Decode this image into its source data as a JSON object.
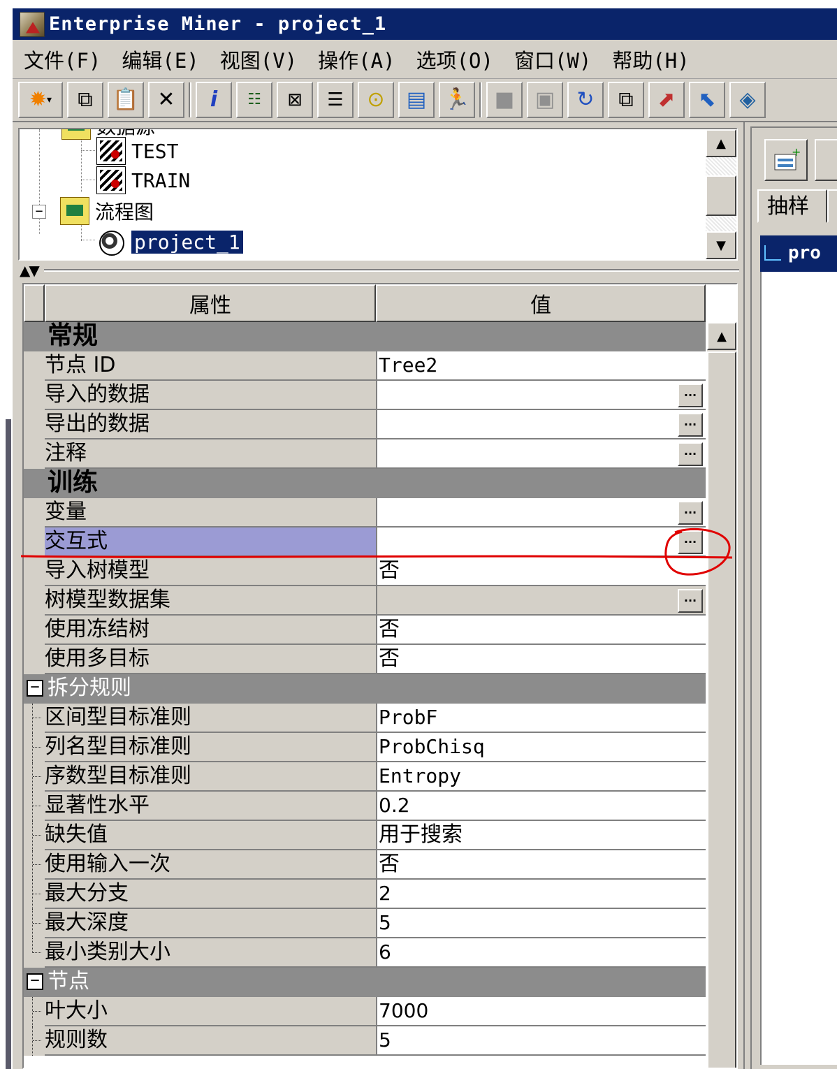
{
  "window": {
    "title": "Enterprise Miner - project_1"
  },
  "menu": [
    "文件(F)",
    "编辑(E)",
    "视图(V)",
    "操作(A)",
    "选项(O)",
    "窗口(W)",
    "帮助(H)"
  ],
  "toolbar": {
    "icons": [
      "new-star-icon",
      "copy-icon",
      "paste-icon",
      "delete-icon",
      "info-icon",
      "tree-view-icon",
      "edit-node-icon",
      "notepad-icon",
      "results-icon",
      "library-icon",
      "run-icon",
      "stop-icon",
      "report-icon",
      "refresh-icon",
      "windows-icon",
      "model-icon",
      "open-icon",
      "book-icon"
    ]
  },
  "tree": {
    "clipped_label": "数据源",
    "items": [
      {
        "label": "TEST",
        "type": "table"
      },
      {
        "label": "TRAIN",
        "type": "table"
      },
      {
        "label": "流程图",
        "type": "folder",
        "expander": "−"
      },
      {
        "label": "project_1",
        "type": "project",
        "selected": true
      }
    ]
  },
  "grid": {
    "header_property": "属性",
    "header_value": "值",
    "rows": [
      {
        "kind": "section",
        "name": "常规"
      },
      {
        "kind": "prop",
        "name": "节点 ID",
        "value": "Tree2",
        "mono": true
      },
      {
        "kind": "prop",
        "name": "导入的数据",
        "value": "",
        "button": "..."
      },
      {
        "kind": "prop",
        "name": "导出的数据",
        "value": "",
        "button": "..."
      },
      {
        "kind": "prop",
        "name": "注释",
        "value": "",
        "button": "..."
      },
      {
        "kind": "section",
        "name": "训练"
      },
      {
        "kind": "prop",
        "name": "变量",
        "value": "",
        "button": "..."
      },
      {
        "kind": "prop",
        "name": "交互式",
        "value": "",
        "button": "...",
        "highlight": true
      },
      {
        "kind": "prop",
        "name": "导入树模型",
        "value": "否"
      },
      {
        "kind": "prop",
        "name": "树模型数据集",
        "value": "",
        "button": "...",
        "gray": true
      },
      {
        "kind": "prop",
        "name": "使用冻结树",
        "value": "否"
      },
      {
        "kind": "prop",
        "name": "使用多目标",
        "value": "否"
      },
      {
        "kind": "group",
        "name": "拆分规则",
        "toggle": "−"
      },
      {
        "kind": "child",
        "name": "区间型目标准则",
        "value": "ProbF",
        "mono": true
      },
      {
        "kind": "child",
        "name": "列名型目标准则",
        "value": "ProbChisq",
        "mono": true
      },
      {
        "kind": "child",
        "name": "序数型目标准则",
        "value": "Entropy",
        "mono": true
      },
      {
        "kind": "child",
        "name": "显著性水平",
        "value": "0.2"
      },
      {
        "kind": "child",
        "name": "缺失值",
        "value": "用于搜索"
      },
      {
        "kind": "child",
        "name": "使用输入一次",
        "value": "否"
      },
      {
        "kind": "child",
        "name": "最大分支",
        "value": "2"
      },
      {
        "kind": "child",
        "name": "最大深度",
        "value": "5"
      },
      {
        "kind": "child",
        "name": "最小类别大小",
        "value": "6",
        "last": true
      },
      {
        "kind": "group",
        "name": "节点",
        "toggle": "−"
      },
      {
        "kind": "child",
        "name": "叶大小",
        "value": "7000"
      },
      {
        "kind": "child",
        "name": "规则数",
        "value": "5"
      }
    ]
  },
  "right": {
    "tab_label": "抽样",
    "diagram_tab": "pro"
  },
  "colors": {
    "titlebar": "#0a246a",
    "face": "#d4d0c8",
    "section": "#8c8c8c",
    "highlight": "#9b9bd4",
    "annotation": "#e00000"
  }
}
